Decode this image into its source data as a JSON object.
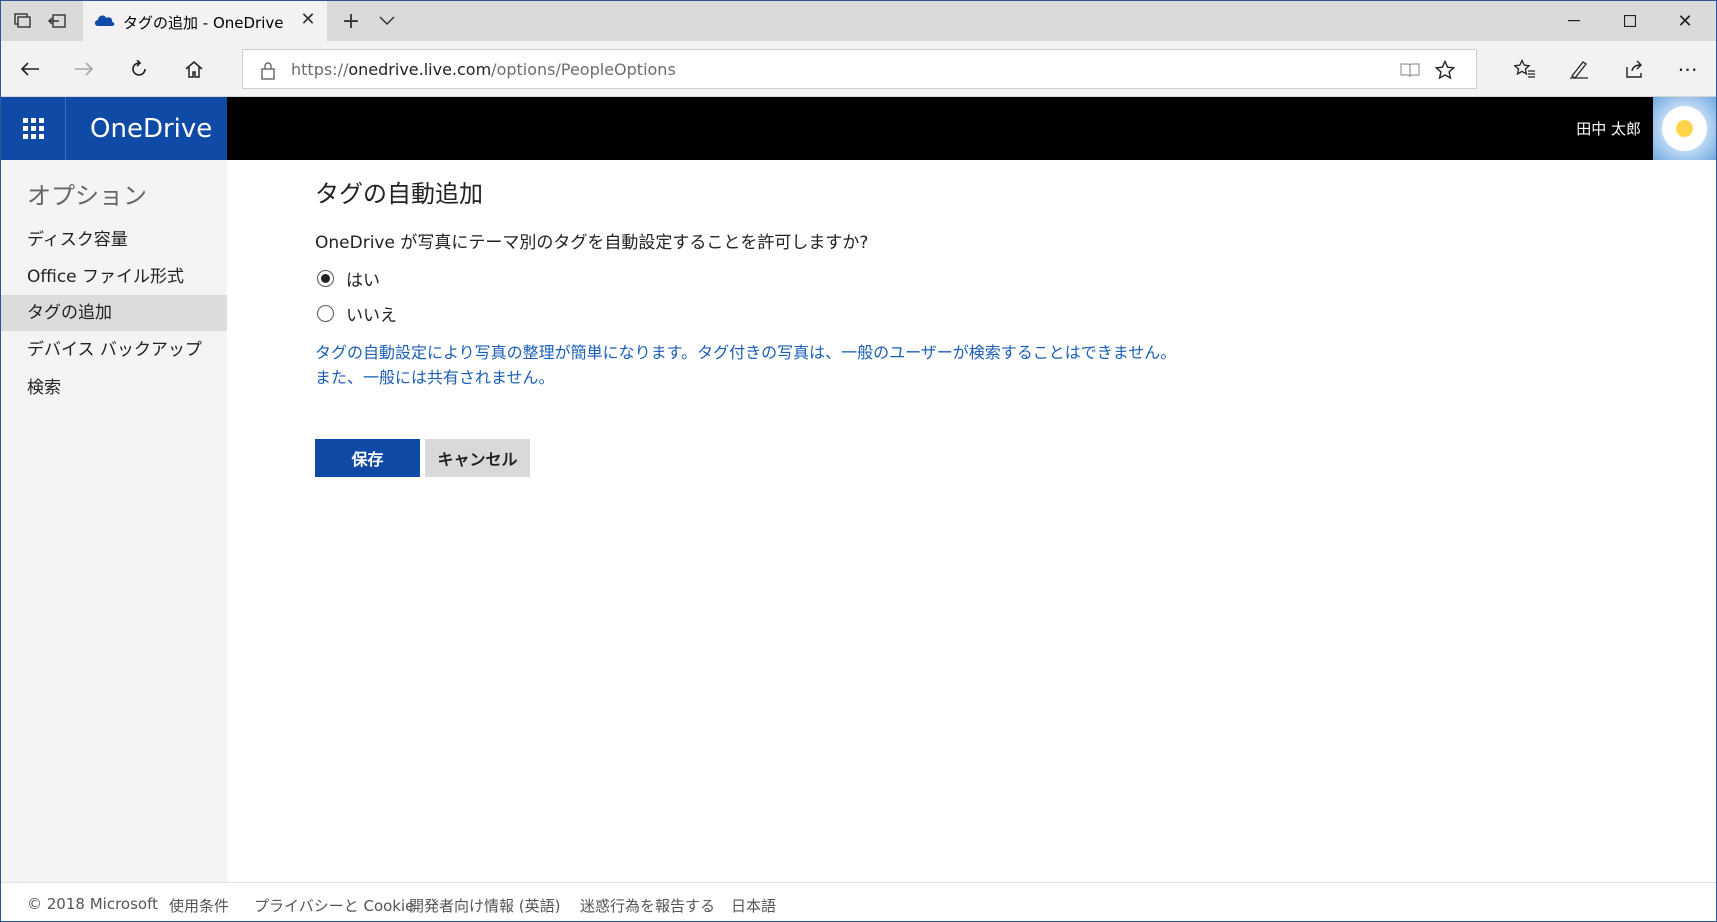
{
  "browser": {
    "tab_title": "タグの追加 - OneDrive",
    "url_prefix": "https://",
    "url_host": "onedrive.live.com",
    "url_path": "/options/PeopleOptions"
  },
  "header": {
    "brand": "OneDrive",
    "user_name": "田中 太郎"
  },
  "sidebar": {
    "title": "オプション",
    "items": [
      {
        "label": "ディスク容量"
      },
      {
        "label": "Office ファイル形式"
      },
      {
        "label": "タグの追加"
      },
      {
        "label": "デバイス バックアップ"
      },
      {
        "label": "検索"
      }
    ]
  },
  "main": {
    "title": "タグの自動追加",
    "question": "OneDrive が写真にテーマ別のタグを自動設定することを許可しますか?",
    "options": [
      {
        "label": "はい",
        "selected": true
      },
      {
        "label": "いいえ",
        "selected": false
      }
    ],
    "info_line1": "タグの自動設定により写真の整理が簡単になります。タグ付きの写真は、一般のユーザーが検索することはできません。",
    "info_line2": "また、一般には共有されません。",
    "save_label": "保存",
    "cancel_label": "キャンセル"
  },
  "footer": {
    "copyright": "© 2018 Microsoft",
    "links": [
      {
        "label": "使用条件"
      },
      {
        "label": "プライバシーと Cookie"
      },
      {
        "label": "開発者向け情報 (英語)"
      },
      {
        "label": "迷惑行為を報告する"
      },
      {
        "label": "日本語"
      }
    ]
  },
  "colors": {
    "brand_blue": "#0f4aa6",
    "info_text": "#1c5fb8",
    "header_bg": "#000000"
  }
}
